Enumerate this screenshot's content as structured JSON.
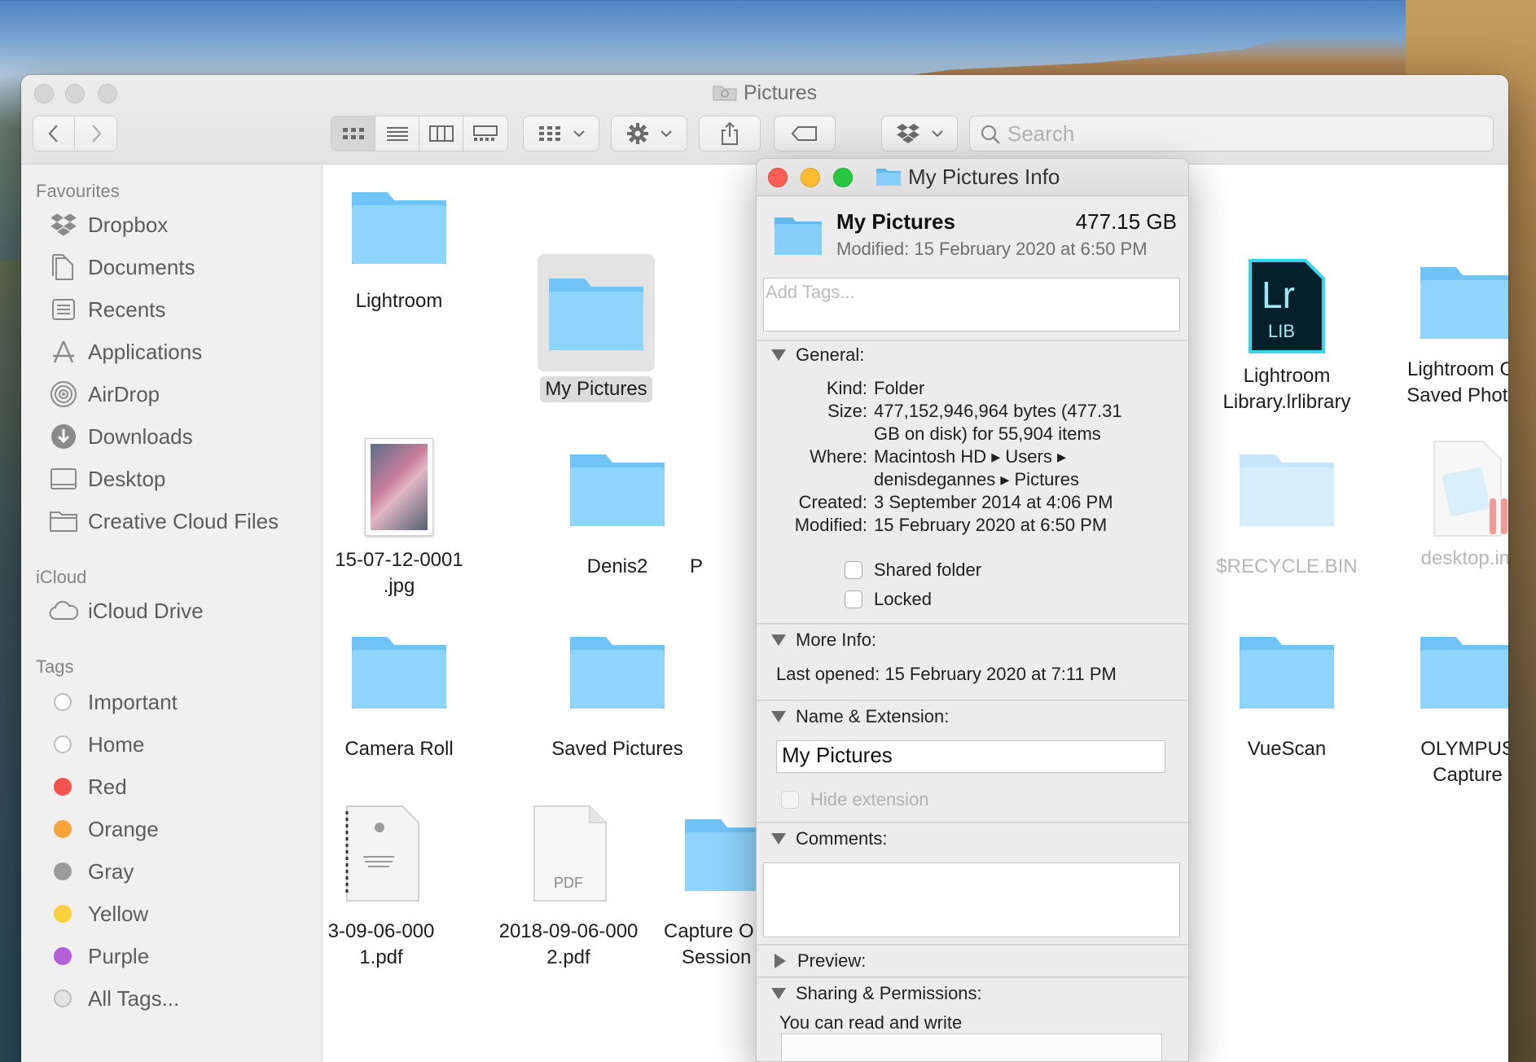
{
  "finder": {
    "window_title": "Pictures",
    "search_placeholder": "Search"
  },
  "sidebar": {
    "favourites_heading": "Favourites",
    "favourites": [
      {
        "label": "Dropbox",
        "icon": "dropbox-icon"
      },
      {
        "label": "Documents",
        "icon": "documents-icon"
      },
      {
        "label": "Recents",
        "icon": "recents-icon"
      },
      {
        "label": "Applications",
        "icon": "applications-icon"
      },
      {
        "label": "AirDrop",
        "icon": "airdrop-icon"
      },
      {
        "label": "Downloads",
        "icon": "downloads-icon"
      },
      {
        "label": "Desktop",
        "icon": "desktop-icon"
      },
      {
        "label": "Creative Cloud Files",
        "icon": "folder-icon"
      }
    ],
    "icloud_heading": "iCloud",
    "icloud": [
      {
        "label": "iCloud Drive",
        "icon": "cloud-icon"
      }
    ],
    "tags_heading": "Tags",
    "tags": [
      {
        "label": "Important",
        "color": "#ffffff"
      },
      {
        "label": "Home",
        "color": "#ffffff"
      },
      {
        "label": "Red",
        "color": "#f4524d"
      },
      {
        "label": "Orange",
        "color": "#f7a23b"
      },
      {
        "label": "Gray",
        "color": "#9a9a9a"
      },
      {
        "label": "Yellow",
        "color": "#f8cf3d"
      },
      {
        "label": "Purple",
        "color": "#b560d8"
      },
      {
        "label": "All Tags...",
        "color": "#e4e4e4"
      }
    ]
  },
  "files": {
    "lightroom": {
      "line1": "Lightroom"
    },
    "my_pictures": {
      "line1": "My Pictures"
    },
    "lr_library": {
      "line1": "Lightroom",
      "line2": "Library.lrlibrary",
      "badge_top": "Lr",
      "badge_bottom": "LIB"
    },
    "lr_cc": {
      "line1": "Lightroom CC",
      "line2": "Saved Photos"
    },
    "jpg": {
      "line1": "15-07-12-0001",
      "line2": ".jpg"
    },
    "denis2": {
      "line1": "Denis2"
    },
    "partial_p": {
      "line1": "P"
    },
    "recycle": {
      "line1": "$RECYCLE.BIN"
    },
    "desktop_ini": {
      "line1": "desktop.ini"
    },
    "camera_roll": {
      "line1": "Camera Roll"
    },
    "saved_pictures": {
      "line1": "Saved Pictures"
    },
    "vuescan": {
      "line1": "VueScan"
    },
    "olympus": {
      "line1": "OLYMPUS",
      "line2": "Capture"
    },
    "pdf1": {
      "line1": "3-09-06-000",
      "line2": "1.pdf"
    },
    "pdf2": {
      "line1": "2018-09-06-000",
      "line2": "2.pdf",
      "badge": "PDF"
    },
    "capture": {
      "line1": "Capture O",
      "line2": "Session"
    }
  },
  "info": {
    "title": "My Pictures Info",
    "name": "My Pictures",
    "size": "477.15 GB",
    "modified_line": "Modified: 15 February 2020 at 6:50 PM",
    "tags_placeholder": "Add Tags...",
    "general_heading": "General:",
    "general": {
      "kind_k": "Kind:",
      "kind_v": "Folder",
      "size_k": "Size:",
      "size_v1": "477,152,946,964 bytes (477.31",
      "size_v2": "GB on disk) for 55,904 items",
      "where_k": "Where:",
      "where_v1": "Macintosh HD ▸ Users ▸",
      "where_v2": "denisdegannes ▸ Pictures",
      "created_k": "Created:",
      "created_v": "3 September 2014 at 4:06 PM",
      "modified_k": "Modified:",
      "modified_v": "15 February 2020 at 6:50 PM"
    },
    "shared_folder": "Shared folder",
    "locked": "Locked",
    "more_info_heading": "More Info:",
    "last_opened": "Last opened: 15 February 2020 at 7:11 PM",
    "name_ext_heading": "Name & Extension:",
    "name_value": "My Pictures",
    "hide_extension": "Hide extension",
    "comments_heading": "Comments:",
    "preview_heading": "Preview:",
    "sharing_heading": "Sharing & Permissions:",
    "sharing_text": "You can read and write"
  }
}
